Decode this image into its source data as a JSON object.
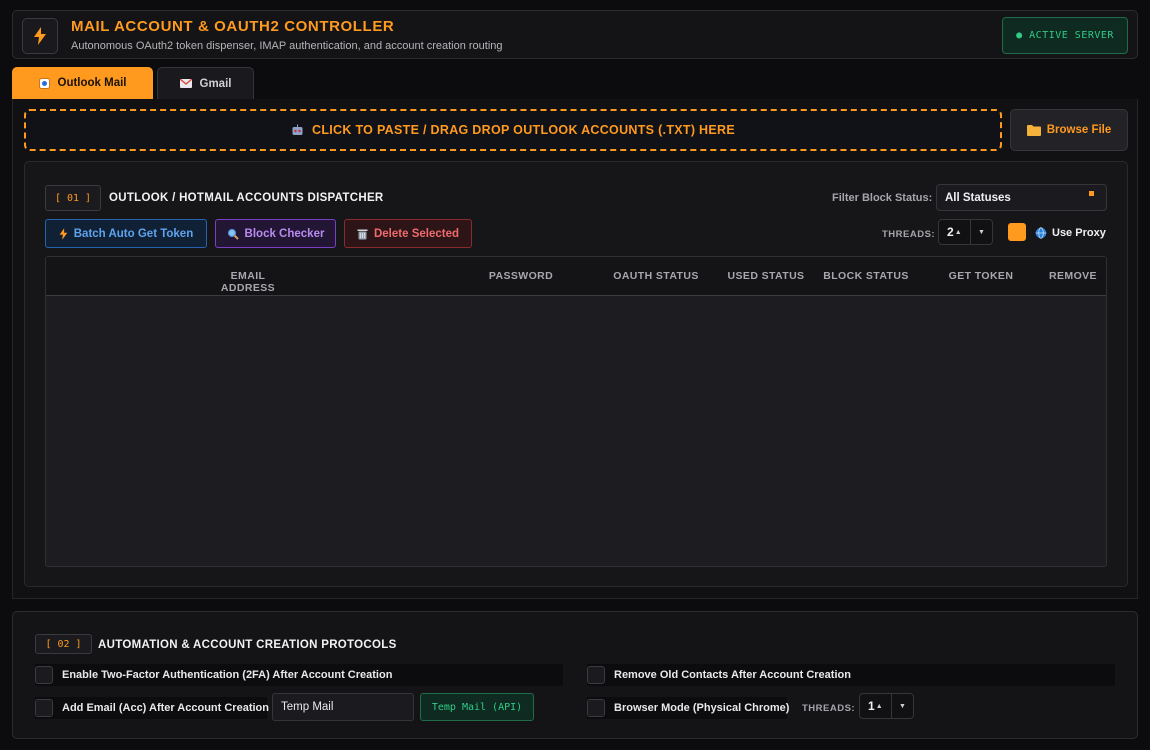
{
  "header": {
    "title": "MAIL ACCOUNT & OAUTH2 CONTROLLER",
    "subtitle": "Autonomous OAuth2 token dispenser, IMAP authentication, and account creation routing",
    "status_badge": "● ACTIVE SERVER",
    "logo_icon": "lightning-icon"
  },
  "tabs": [
    {
      "label": "Outlook Mail",
      "icon": "outlook-icon",
      "active": true
    },
    {
      "label": "Gmail",
      "icon": "gmail-icon",
      "active": false
    }
  ],
  "upload": {
    "dropzone_label": "CLICK TO PASTE / DRAG DROP OUTLOOK ACCOUNTS (.TXT) HERE",
    "browse_label": "Browse File"
  },
  "dispatcher": {
    "section_number": "[ 01 ]",
    "title": "OUTLOOK / HOTMAIL ACCOUNTS DISPATCHER",
    "filter_label": "Filter Block Status:",
    "filter_value": "All Statuses",
    "buttons": {
      "batch": "Batch Auto Get Token",
      "block": "Block Checker",
      "delete": "Delete Selected"
    },
    "threads_label": "THREADS:",
    "threads_value": "2",
    "proxy_label": "Use Proxy",
    "proxy_checked": true,
    "columns": [
      "EMAIL ADDRESS",
      "PASSWORD",
      "OAUTH STATUS",
      "USED STATUS",
      "BLOCK STATUS",
      "GET TOKEN",
      "REMOVE"
    ],
    "rows": []
  },
  "automation": {
    "section_number": "[ 02 ]",
    "title": "AUTOMATION & ACCOUNT CREATION PROTOCOLS",
    "options": {
      "twofa": "Enable Two-Factor Authentication (2FA) After Account Creation",
      "remove_contacts": "Remove Old Contacts After Account Creation",
      "add_email": "Add Email (Acc) After Account Creation",
      "browser_mode": "Browser Mode (Physical Chrome)"
    },
    "temp_mail_value": "Temp Mail",
    "temp_mail_api": "Temp Mail (API)",
    "threads_label": "THREADS:",
    "threads_value": "1"
  },
  "colors": {
    "accent": "#ff9a1f",
    "success": "#2ecc87",
    "info": "#5ea3ee",
    "purple": "#b98af0",
    "danger": "#ee6b6e"
  }
}
